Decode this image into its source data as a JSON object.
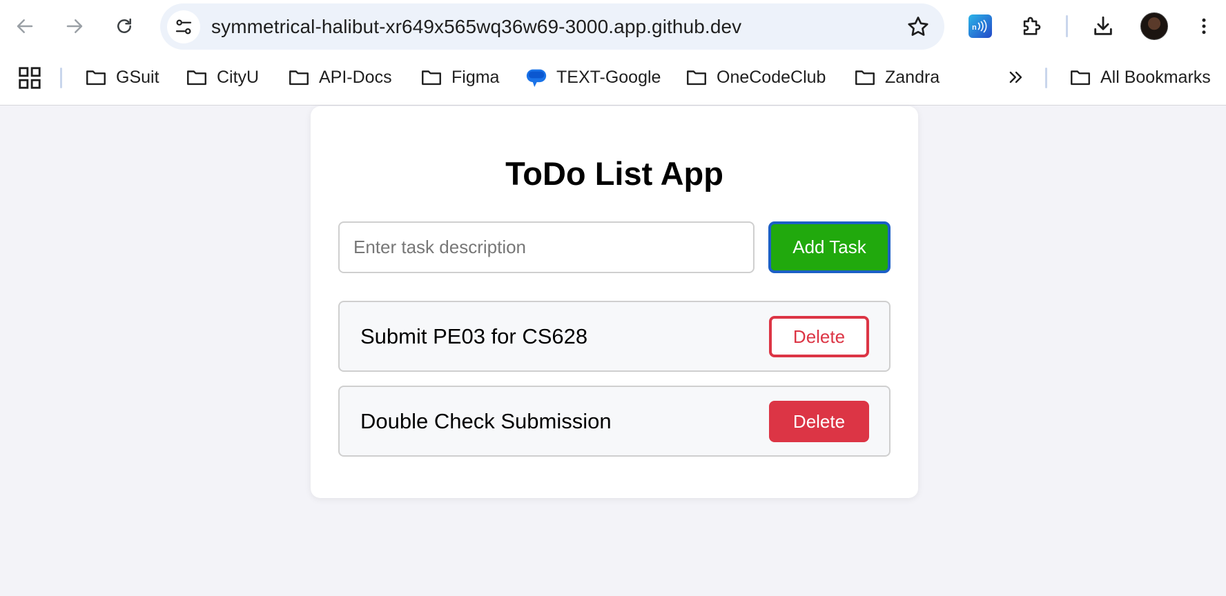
{
  "browser": {
    "url": "symmetrical-halibut-xr649x565wq36w69-3000.app.github.dev",
    "bookmarks": [
      {
        "label": "GSuit",
        "icon": "folder-icon"
      },
      {
        "label": "CityU",
        "icon": "folder-icon"
      },
      {
        "label": "API-Docs",
        "icon": "folder-icon"
      },
      {
        "label": "Figma",
        "icon": "folder-icon"
      },
      {
        "label": "TEXT-Google",
        "icon": "message-bubble-icon"
      },
      {
        "label": "OneCodeClub",
        "icon": "folder-icon"
      },
      {
        "label": "Zandra",
        "icon": "folder-icon"
      }
    ],
    "all_bookmarks_label": "All Bookmarks"
  },
  "app": {
    "title": "ToDo List App",
    "input_placeholder": "Enter task description",
    "input_value": "",
    "add_button_label": "Add Task",
    "tasks": [
      {
        "text": "Submit PE03 for CS628",
        "delete_label": "Delete",
        "delete_style": "outline"
      },
      {
        "text": "Double Check Submission",
        "delete_label": "Delete",
        "delete_style": "solid"
      }
    ]
  },
  "colors": {
    "page_background": "#f3f3f8",
    "add_button": "#21a90d",
    "add_button_focus_ring": "#1c5fc6",
    "delete_red": "#dc3545"
  }
}
